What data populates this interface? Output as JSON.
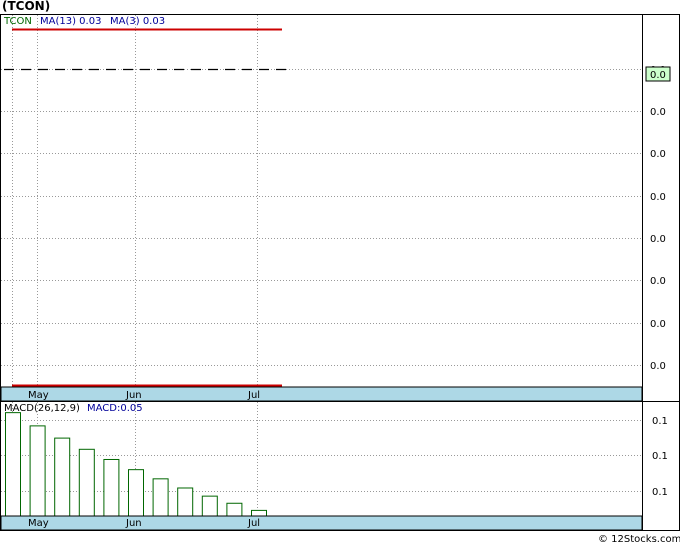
{
  "title": "(TCON)",
  "copyright": "© 12Stocks.com",
  "colors": {
    "price_line": "#cc0000",
    "ticker_label": "#006600",
    "ma_label": "#000099",
    "macd_bar": "#006600",
    "axis_band": "#add8e6",
    "last_price_fill": "#ccffcc",
    "grid": "#999999"
  },
  "chart_data": [
    {
      "type": "line",
      "legend": {
        "ticker": "TCON",
        "ma13": "MA(13)  0.03",
        "ma3": "MA(3)  0.03"
      },
      "x_ticks": [
        "May",
        "Jun",
        "Jul"
      ],
      "y_tick_labels": [
        "0.0",
        "0.0",
        "0.0",
        "0.0",
        "0.0",
        "0.0",
        "0.0",
        "0.0"
      ],
      "last_price_label": "0.0",
      "series": [
        {
          "values": [
            0.03,
            0.03
          ]
        },
        {
          "values": [
            0.03,
            0.03
          ]
        }
      ],
      "grid": true
    },
    {
      "type": "bar",
      "legend": {
        "name": "MACD(26,12,9)",
        "value": "MACD:0.05"
      },
      "x_ticks": [
        "May",
        "Jun",
        "Jul"
      ],
      "y_tick_labels": [
        "0.1",
        "0.1",
        "0.1"
      ],
      "values": [
        0.102,
        0.089,
        0.077,
        0.066,
        0.056,
        0.046,
        0.037,
        0.028,
        0.02,
        0.013,
        0.006
      ],
      "ylim": [
        0,
        0.11
      ],
      "grid": true
    }
  ]
}
